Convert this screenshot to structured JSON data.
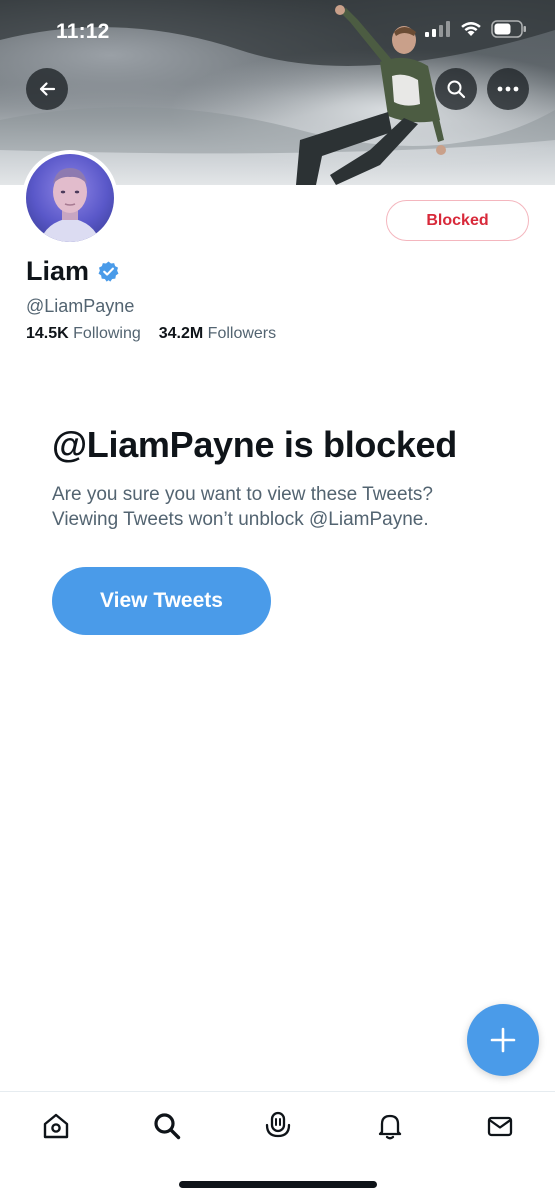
{
  "status_bar": {
    "time": "11:12"
  },
  "header": {
    "back_icon": "arrow-left-icon",
    "search_icon": "search-icon",
    "more_icon": "more-horizontal-icon"
  },
  "profile": {
    "display_name": "Liam",
    "verified": true,
    "handle": "@LiamPayne",
    "following_count": "14.5K",
    "following_label": "Following",
    "followers_count": "34.2M",
    "followers_label": "Followers",
    "blocked_button_label": "Blocked"
  },
  "blocked_notice": {
    "title": "@LiamPayne is blocked",
    "message": "Are you sure you want to view these Tweets? Viewing Tweets won’t unblock @LiamPayne.",
    "view_button_label": "View Tweets"
  },
  "fab": {
    "icon": "plus-icon"
  },
  "tabbar": {
    "items": [
      {
        "name": "home",
        "icon": "home-icon"
      },
      {
        "name": "search",
        "icon": "search-icon"
      },
      {
        "name": "spaces",
        "icon": "spaces-icon"
      },
      {
        "name": "notifications",
        "icon": "bell-icon"
      },
      {
        "name": "messages",
        "icon": "mail-icon"
      }
    ]
  },
  "colors": {
    "accent": "#4a9be9",
    "blocked_red": "#d8293a",
    "secondary_text": "#536471",
    "primary_text": "#0f1419"
  }
}
